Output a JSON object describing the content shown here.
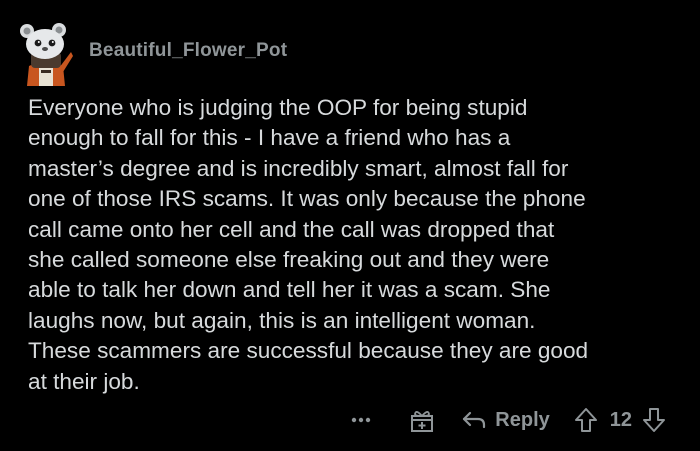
{
  "comment": {
    "author": "Beautiful_Flower_Pot",
    "text": "Everyone who is judging the OOP for being stupid\nenough to fall for this - I have a friend who has a\nmaster’s degree and is incredibly smart, almost fall for\none of those IRS scams.  It was only because the phone\ncall came onto her cell and the call was dropped that\nshe called someone else freaking out and they were\nable to talk her down and tell her it was a scam.  She\nlaughs now, but again, this is an intelligent woman.\nThese scammers are successful because they are good\nat their job.",
    "actions": {
      "more_label": "•••",
      "reply_label": "Reply",
      "score": "12"
    }
  },
  "icons": {
    "avatar": "snoo-avatar",
    "more": "ellipsis-icon",
    "award": "gift-award-icon",
    "reply": "reply-arrow-icon",
    "upvote": "upvote-arrow-icon",
    "downvote": "downvote-arrow-icon"
  },
  "colors": {
    "background": "#000000",
    "text": "#d7dadc",
    "muted": "#8f9598"
  }
}
